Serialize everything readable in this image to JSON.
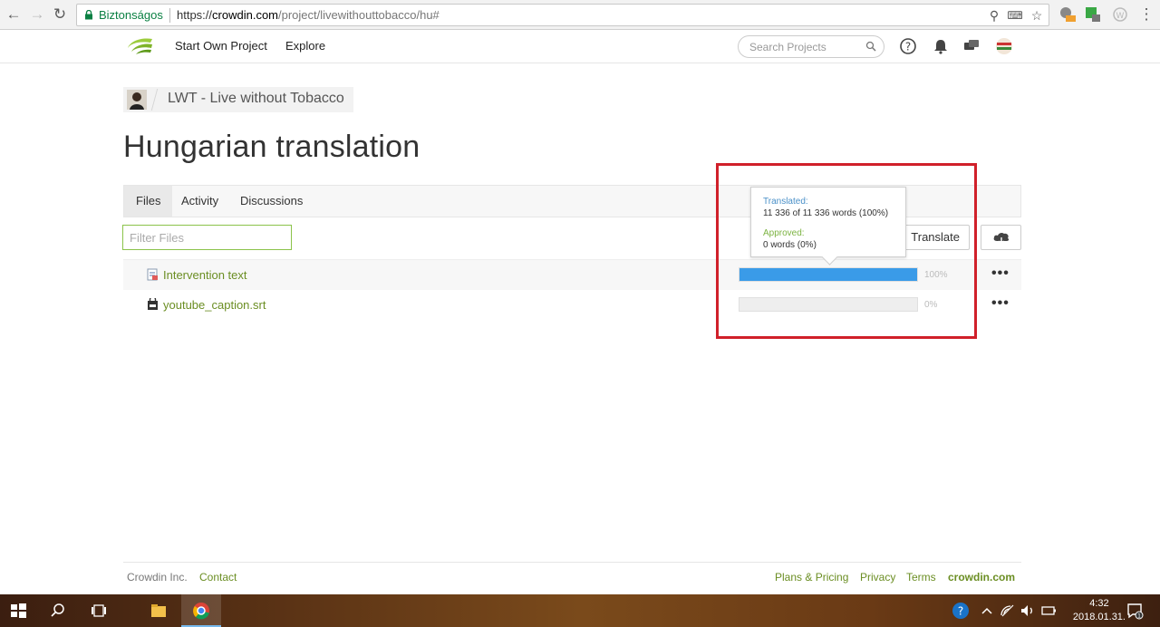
{
  "browser": {
    "secure_label": "Biztonságos",
    "url_scheme": "https://",
    "url_host": "crowdin.com",
    "url_path": "/project/livewithouttobacco/hu#"
  },
  "header": {
    "nav_items": [
      "Start Own Project",
      "Explore"
    ],
    "search_placeholder": "Search Projects"
  },
  "breadcrumb": {
    "project": "LWT - Live without Tobacco"
  },
  "page": {
    "title": "Hungarian translation"
  },
  "tabs": [
    {
      "label": "Files",
      "active": true
    },
    {
      "label": "Activity",
      "active": false
    },
    {
      "label": "Discussions",
      "active": false
    }
  ],
  "toolbar": {
    "filter_placeholder": "Filter Files",
    "translate_all": "Translate All"
  },
  "files": [
    {
      "name": "Intervention text",
      "progress": 100,
      "progress_label": "100%"
    },
    {
      "name": "youtube_caption.srt",
      "progress": 0,
      "progress_label": "0%"
    }
  ],
  "tooltip": {
    "translated_label": "Translated:",
    "translated_value": "11 336 of 11 336 words (100%)",
    "approved_label": "Approved:",
    "approved_value": "0 words (0%)"
  },
  "footer": {
    "left": [
      "Crowdin Inc.",
      "Contact"
    ],
    "right": [
      "Plans & Pricing",
      "Privacy",
      "Terms"
    ],
    "brand": "crowdin.com"
  },
  "taskbar": {
    "time": "4:32",
    "date": "2018.01.31."
  },
  "colors": {
    "accent_green": "#6b8e23",
    "progress_blue": "#3a9be8",
    "highlight_red": "#d0202a"
  }
}
